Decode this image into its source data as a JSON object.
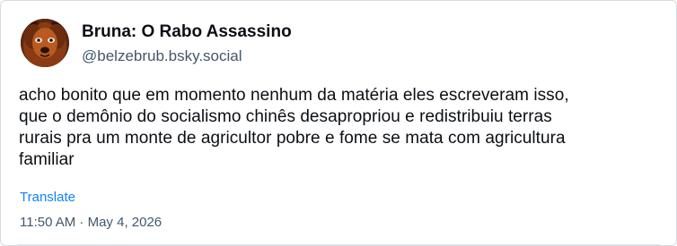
{
  "post": {
    "author": {
      "display_name": "Bruna: O Rabo Assassino",
      "handle": "@belzebrub.bsky.social"
    },
    "text_lines": [
      "acho bonito que em momento nenhum da matéria eles escreveram isso,",
      "que o demônio do socialismo chinês desapropriou e redistribuiu terras",
      "rurais pra um monte de agricultor pobre e fome se mata com agricultura",
      "familiar"
    ],
    "translate_label": "Translate",
    "timestamp": "11:50 AM · May 4, 2026"
  },
  "colors": {
    "text_primary": "#0b0f14",
    "text_secondary": "#42576c",
    "link": "#1083fe",
    "border": "#d4dbe2"
  }
}
